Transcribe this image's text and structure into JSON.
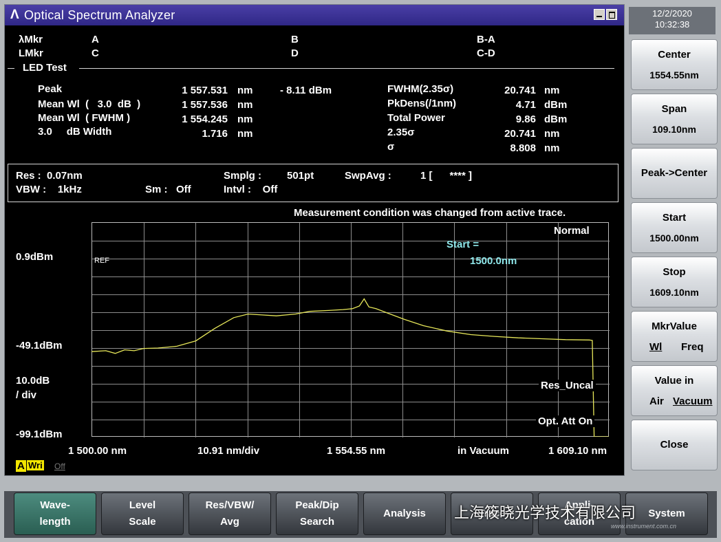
{
  "window": {
    "logo": "Λ",
    "title": "Optical Spectrum Analyzer"
  },
  "clock": {
    "date": "12/2/2020",
    "time": "10:32:38"
  },
  "markers": {
    "row1": [
      "λMkr",
      "A",
      "B",
      "B-A"
    ],
    "row2": [
      "LMkr",
      "C",
      "D",
      "C-D"
    ]
  },
  "led_test": {
    "section_label": "LED Test",
    "rows": [
      {
        "label": "Peak",
        "value": "1 557.531",
        "unit": "nm",
        "extra": "- 8.11 dBm"
      },
      {
        "label": "Mean Wl  (   3.0  dB  )",
        "value": "1 557.536",
        "unit": "nm"
      },
      {
        "label": "Mean Wl  ( FWHM )",
        "value": "1 554.245",
        "unit": "nm"
      },
      {
        "label": "3.0     dB Width",
        "value": "1.716",
        "unit": "nm"
      }
    ],
    "right_rows": [
      {
        "label": "FWHM(2.35σ)",
        "value": "20.741",
        "unit": "nm"
      },
      {
        "label": "PkDens(/1nm)",
        "value": "4.71",
        "unit": "dBm"
      },
      {
        "label": "Total Power",
        "value": "9.86",
        "unit": "dBm"
      },
      {
        "label": "2.35σ",
        "value": "20.741",
        "unit": "nm"
      },
      {
        "label": "σ",
        "value": "8.808",
        "unit": "nm"
      }
    ]
  },
  "conditions": {
    "res": "Res :  0.07nm",
    "vbw": "VBW :    1kHz",
    "smplg_label": "Smplg :",
    "smplg_value": "501pt",
    "swpavg_label": "SwpAvg :",
    "swpavg_value": "1 [      **** ]",
    "sm": "Sm :   Off",
    "intvl": "Intvl :    Off"
  },
  "plot": {
    "message": "Measurement condition was changed from active trace.",
    "mode": "Normal",
    "start_label": "Start =",
    "start_value": "1500.0nm",
    "ref_tag": "REF",
    "y_top": "0.9dBm",
    "y_mid": "-49.1dBm",
    "scale": "10.0dB",
    "scale_unit": "/ div",
    "y_bottom": "-99.1dBm",
    "res_uncal": "Res_Uncal",
    "opt_att": "Opt. Att On",
    "x_start": "1 500.00 nm",
    "x_div": "10.91 nm/div",
    "x_center": "1 554.55 nm",
    "x_medium": "in Vacuum",
    "x_stop": "1 609.10 nm",
    "trace_letter": "A",
    "trace_mode": "Wri",
    "trace_state": "Off",
    "trace_color": "#e8e85a"
  },
  "chart_data": {
    "type": "line",
    "title": "",
    "xlabel": "",
    "ylabel": "",
    "xlim": [
      1500.0,
      1609.1
    ],
    "ylim": [
      -99.1,
      0.9
    ],
    "x": [
      1500,
      1503,
      1505,
      1507,
      1509,
      1511,
      1514,
      1518,
      1522,
      1526,
      1530,
      1533,
      1536,
      1539,
      1541,
      1543,
      1546,
      1550,
      1553,
      1555,
      1556.5,
      1557.5,
      1558.5,
      1560,
      1563,
      1566,
      1570,
      1575,
      1580,
      1585,
      1590,
      1595,
      1600,
      1605,
      1605.6,
      1606,
      1609.1
    ],
    "y": [
      -51.5,
      -51.0,
      -52.5,
      -50.5,
      -51.0,
      -49.7,
      -49.5,
      -48.5,
      -45.5,
      -38.5,
      -32.5,
      -30.5,
      -31.0,
      -31.5,
      -31.0,
      -30.5,
      -29.0,
      -28.5,
      -28.0,
      -27.5,
      -26.0,
      -22.0,
      -26.5,
      -27.5,
      -30.5,
      -33.5,
      -37.0,
      -40.0,
      -42.0,
      -43.0,
      -43.8,
      -44.3,
      -44.8,
      -45.0,
      -45.2,
      -99.1,
      -99.1
    ]
  },
  "side_buttons": [
    {
      "l1": "Center",
      "l2": "1554.55nm"
    },
    {
      "l1": "Span",
      "l2": "109.10nm"
    },
    {
      "single": "Peak->Center"
    },
    {
      "l1": "Start",
      "l2": "1500.00nm"
    },
    {
      "l1": "Stop",
      "l2": "1609.10nm"
    },
    {
      "l1": "MkrValue",
      "opt_a": "Wl",
      "opt_b": "Freq"
    },
    {
      "l1": "Value in",
      "opt_a": "Air",
      "opt_b": "Vacuum"
    },
    {
      "single": "Close"
    }
  ],
  "bottom_buttons": [
    {
      "l1": "Wave-",
      "l2": "length"
    },
    {
      "l1": "Level",
      "l2": "Scale"
    },
    {
      "l1": "Res/VBW/",
      "l2": "Avg"
    },
    {
      "l1": "Peak/Dip",
      "l2": "Search"
    },
    {
      "single": "Analysis"
    },
    {
      "single": "Trace"
    },
    {
      "l1": "Appli-",
      "l2": "cation"
    },
    {
      "single": "System"
    }
  ],
  "watermark": {
    "text": "上海筱晓光学技术有限公司",
    "site": "www.instrument.com.cn"
  }
}
